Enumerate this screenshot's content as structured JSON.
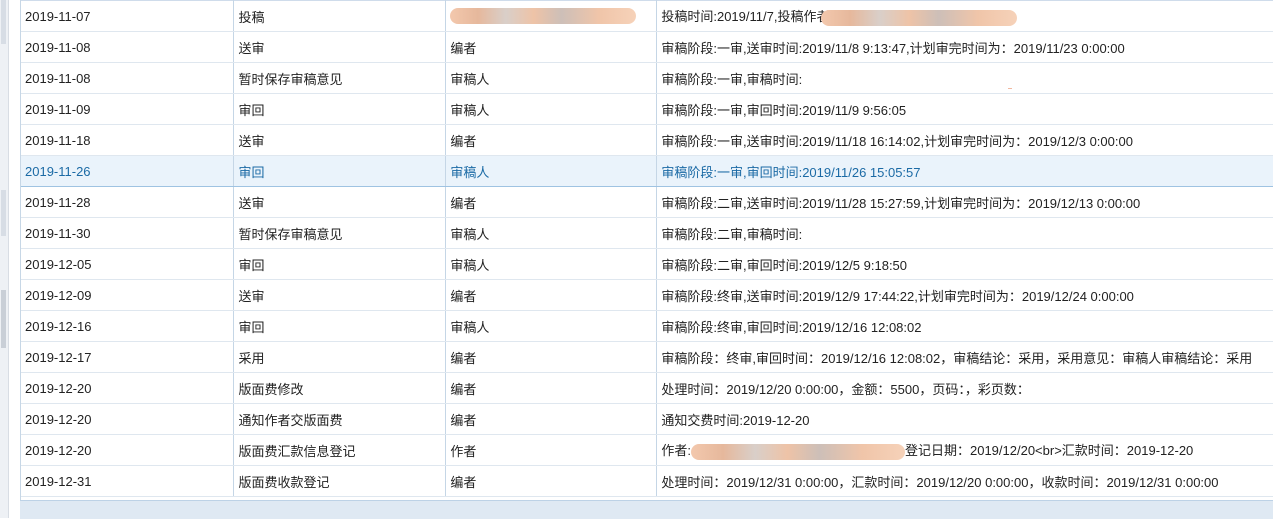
{
  "rows": [
    {
      "date": "2019-11-07",
      "action": "投稿",
      "role": "",
      "detail_prefix": "投稿时间:2019/11/7,投稿作者",
      "detail_suffix": "",
      "role_redacted": true,
      "detail_redacted": true,
      "selected": false
    },
    {
      "date": "2019-11-08",
      "action": "送审",
      "role": "编者",
      "detail_prefix": "审稿阶段:一审,送审时间:2019/11/8 9:13:47,计划审完时间为：2019/11/23 0:00:00",
      "detail_suffix": "",
      "selected": false
    },
    {
      "date": "2019-11-08",
      "action": "暂时保存审稿意见",
      "role": "审稿人",
      "detail_prefix": "审稿阶段:一审,审稿时间:",
      "detail_suffix": "",
      "selected": false
    },
    {
      "date": "2019-11-09",
      "action": "审回",
      "role": "审稿人",
      "detail_prefix": "审稿阶段:一审,审回时间:2019/11/9 9:56:05",
      "detail_suffix": "",
      "selected": false
    },
    {
      "date": "2019-11-18",
      "action": "送审",
      "role": "编者",
      "detail_prefix": "审稿阶段:一审,送审时间:2019/11/18 16:14:02,计划审完时间为：2019/12/3 0:00:00",
      "detail_suffix": "",
      "selected": false
    },
    {
      "date": "2019-11-26",
      "action": "审回",
      "role": "审稿人",
      "detail_prefix": "审稿阶段:一审,审回时间:2019/11/26 15:05:57",
      "detail_suffix": "",
      "selected": true
    },
    {
      "date": "2019-11-28",
      "action": "送审",
      "role": "编者",
      "detail_prefix": "审稿阶段:二审,送审时间:2019/11/28 15:27:59,计划审完时间为：2019/12/13 0:00:00",
      "detail_suffix": "",
      "selected": false
    },
    {
      "date": "2019-11-30",
      "action": "暂时保存审稿意见",
      "role": "审稿人",
      "detail_prefix": "审稿阶段:二审,审稿时间:",
      "detail_suffix": "",
      "selected": false
    },
    {
      "date": "2019-12-05",
      "action": "审回",
      "role": "审稿人",
      "detail_prefix": "审稿阶段:二审,审回时间:2019/12/5 9:18:50",
      "detail_suffix": "",
      "selected": false
    },
    {
      "date": "2019-12-09",
      "action": "送审",
      "role": "编者",
      "detail_prefix": "审稿阶段:终审,送审时间:2019/12/9 17:44:22,计划审完时间为：2019/12/24 0:00:00",
      "detail_suffix": "",
      "selected": false
    },
    {
      "date": "2019-12-16",
      "action": "审回",
      "role": "审稿人",
      "detail_prefix": "审稿阶段:终审,审回时间:2019/12/16 12:08:02",
      "detail_suffix": "",
      "selected": false
    },
    {
      "date": "2019-12-17",
      "action": "采用",
      "role": "编者",
      "detail_prefix": "审稿阶段：终审,审回时间：2019/12/16 12:08:02，审稿结论：采用，采用意见：审稿人审稿结论：采用",
      "detail_suffix": "",
      "selected": false
    },
    {
      "date": "2019-12-20",
      "action": "版面费修改",
      "role": "编者",
      "detail_prefix": "处理时间：2019/12/20 0:00:00，金额：5500，页码：，彩页数：",
      "detail_suffix": "",
      "selected": false
    },
    {
      "date": "2019-12-20",
      "action": "通知作者交版面费",
      "role": "编者",
      "detail_prefix": "通知交费时间:2019-12-20",
      "detail_suffix": "",
      "selected": false
    },
    {
      "date": "2019-12-20",
      "action": "版面费汇款信息登记",
      "role": "作者",
      "detail_prefix": "作者:",
      "detail_suffix": "登记日期：2019/12/20<br>汇款时间：2019-12-20",
      "detail_redacted": true,
      "selected": false
    },
    {
      "date": "2019-12-31",
      "action": "版面费收款登记",
      "role": "编者",
      "detail_prefix": "处理时间：2019/12/31 0:00:00，汇款时间：2019/12/20 0:00:00，收款时间：2019/12/31 0:00:00",
      "detail_suffix": "",
      "selected": false
    }
  ],
  "colors": {
    "selected_text": "#1b6aa5",
    "grid_line": "#c5d6e6",
    "redaction": "#f0c2a5"
  }
}
